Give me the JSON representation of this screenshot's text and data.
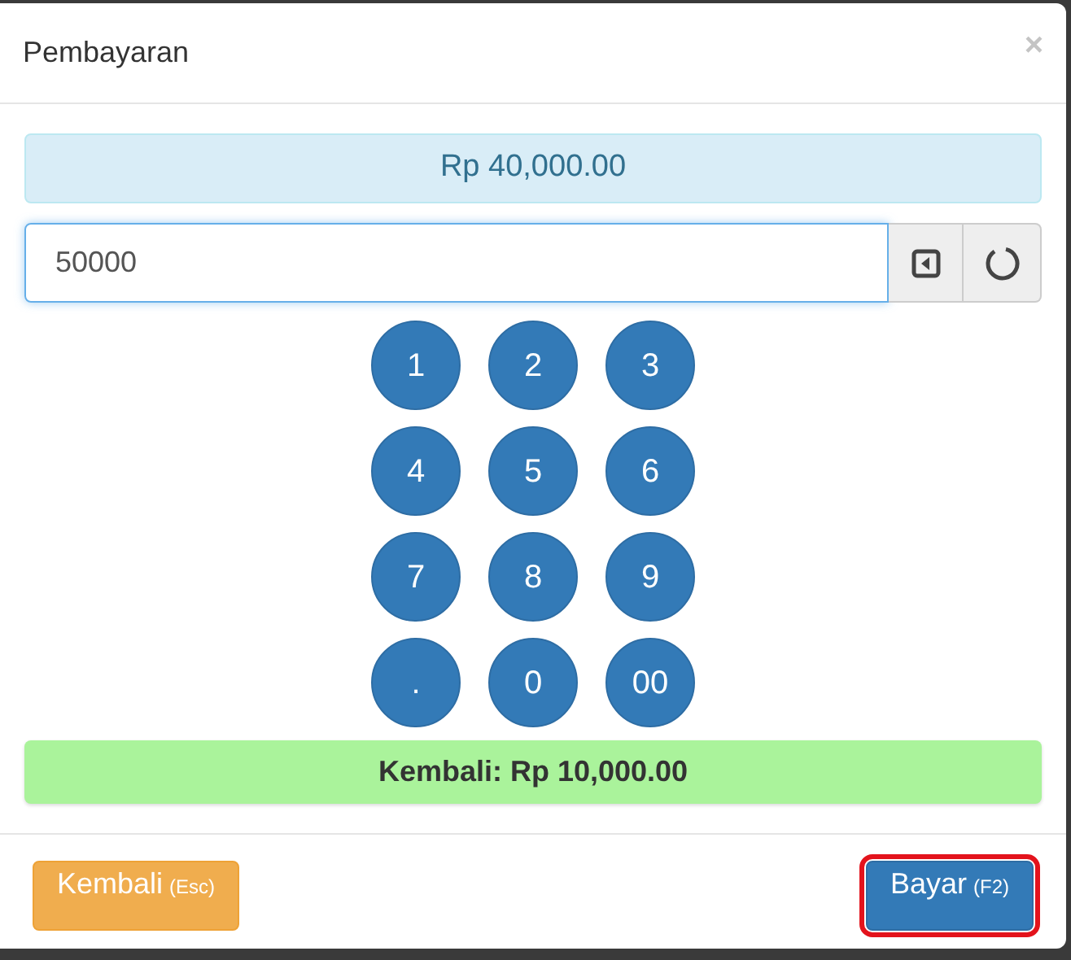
{
  "dialog": {
    "title": "Pembayaran",
    "close": "×"
  },
  "total": "Rp 40,000.00",
  "amount_field": {
    "value": "50000"
  },
  "keypad": [
    [
      "1",
      "2",
      "3"
    ],
    [
      "4",
      "5",
      "6"
    ],
    [
      "7",
      "8",
      "9"
    ],
    [
      ".",
      "0",
      "00"
    ]
  ],
  "change": "Kembali: Rp 10,000.00",
  "buttons": [
    {
      "kind": "cancel",
      "label": "Kembali",
      "shortcut": "(Esc)",
      "focused": false
    },
    {
      "kind": "pay",
      "label": "Bayar",
      "shortcut": "(F2)",
      "focused": true
    }
  ]
}
